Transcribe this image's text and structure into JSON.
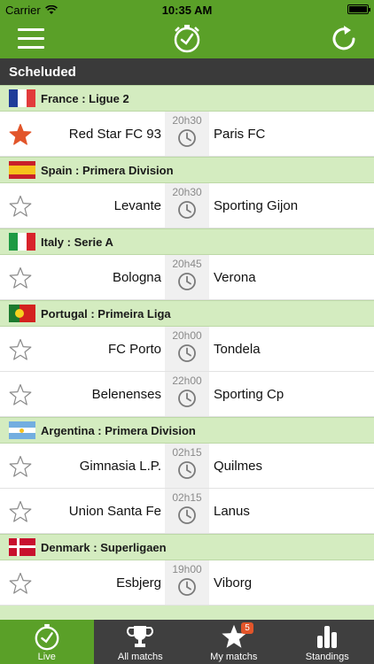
{
  "status": {
    "carrier": "Carrier",
    "time": "10:35 AM"
  },
  "section": {
    "title": "Scheluded"
  },
  "leagues": [
    {
      "flag_icon": "france-flag",
      "name": "France : Ligue 2",
      "matches": [
        {
          "home": "Red Star FC 93",
          "away": "Paris FC",
          "time": "20h30",
          "favorite": true
        }
      ]
    },
    {
      "flag_icon": "spain-flag",
      "name": "Spain : Primera Division",
      "matches": [
        {
          "home": "Levante",
          "away": "Sporting Gijon",
          "time": "20h30",
          "favorite": false
        }
      ]
    },
    {
      "flag_icon": "italy-flag",
      "name": "Italy : Serie A",
      "matches": [
        {
          "home": "Bologna",
          "away": "Verona",
          "time": "20h45",
          "favorite": false
        }
      ]
    },
    {
      "flag_icon": "portugal-flag",
      "name": "Portugal : Primeira Liga",
      "matches": [
        {
          "home": "FC Porto",
          "away": "Tondela",
          "time": "20h00",
          "favorite": false
        },
        {
          "home": "Belenenses",
          "away": "Sporting Cp",
          "time": "22h00",
          "favorite": false
        }
      ]
    },
    {
      "flag_icon": "argentina-flag",
      "name": "Argentina : Primera Division",
      "matches": [
        {
          "home": "Gimnasia L.P.",
          "away": "Quilmes",
          "time": "02h15",
          "favorite": false
        },
        {
          "home": "Union Santa Fe",
          "away": "Lanus",
          "time": "02h15",
          "favorite": false
        }
      ]
    },
    {
      "flag_icon": "denmark-flag",
      "name": "Denmark : Superligaen",
      "matches": [
        {
          "home": "Esbjerg",
          "away": "Viborg",
          "time": "19h00",
          "favorite": false
        }
      ]
    }
  ],
  "tabs": [
    {
      "label": "Live",
      "icon": "clock-icon",
      "active": true
    },
    {
      "label": "All matchs",
      "icon": "trophy-icon",
      "active": false
    },
    {
      "label": "My matchs",
      "icon": "star-icon",
      "active": false,
      "badge": "5"
    },
    {
      "label": "Standings",
      "icon": "bar-chart-icon",
      "active": false
    }
  ],
  "colors": {
    "accent": "#5aa028",
    "header": "#3a3a3a",
    "league_bg": "#d4ecc0",
    "favorite_star": "#e2552a",
    "badge": "#e2552a"
  }
}
